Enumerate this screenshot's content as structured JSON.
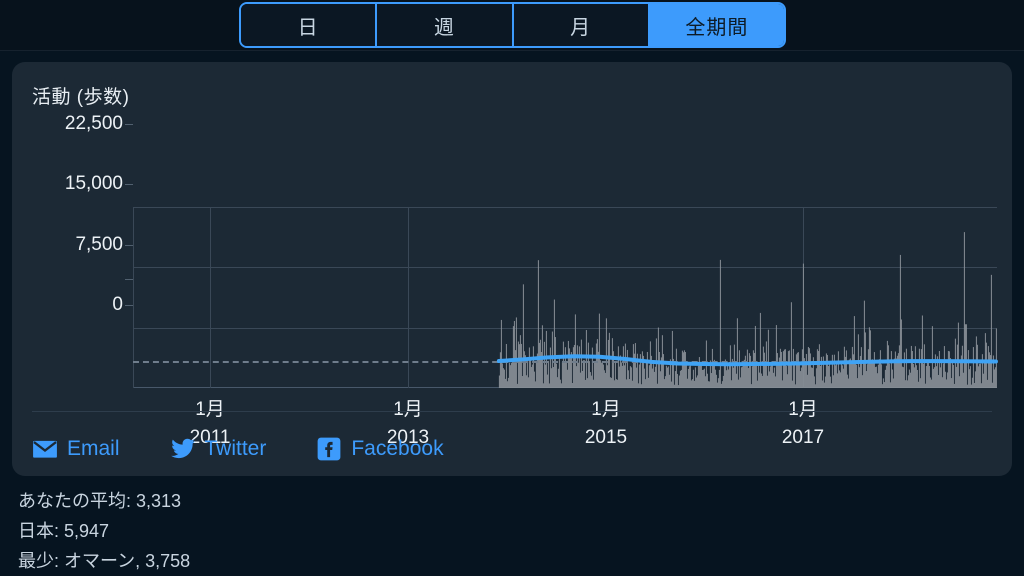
{
  "topbar": {
    "segments": [
      {
        "label": "日",
        "selected": false
      },
      {
        "label": "週",
        "selected": false
      },
      {
        "label": "月",
        "selected": false
      },
      {
        "label": "全期間",
        "selected": true
      }
    ]
  },
  "card": {
    "title": "活動 (歩数)"
  },
  "share": {
    "items": [
      {
        "label": "Email",
        "icon": "email-icon",
        "color": "#3d9bfc"
      },
      {
        "label": "Twitter",
        "icon": "twitter-icon",
        "color": "#3d9bfc"
      },
      {
        "label": "Facebook",
        "icon": "facebook-icon",
        "color": "#3d9bfc"
      }
    ]
  },
  "footer": {
    "lines": [
      "あなたの平均: 3,313",
      "日本: 5,947",
      "最少: オマーン, 3,758"
    ]
  },
  "colors": {
    "accent": "#3d9bfc",
    "page_bg": "#061420",
    "card_bg": "#1c2935",
    "bar": "#8d939b",
    "trend": "#3fa3f5",
    "grid": "#3a4857",
    "dashed": "#6f7d8c"
  },
  "chart_data": {
    "type": "bar",
    "title": "活動 (歩数)",
    "xlabel": "",
    "ylabel": "歩数",
    "ylim": [
      0,
      22500
    ],
    "yticks": [
      0,
      7500,
      15000,
      22500
    ],
    "ytick_labels": [
      "0",
      "7,500",
      "15,000",
      "22,500"
    ],
    "grid": true,
    "legend": "none",
    "x_range": [
      "2010-01",
      "2018-12"
    ],
    "xticks": [
      {
        "position": 0.0893,
        "label_line1": "1月",
        "label_line2": "2011"
      },
      {
        "position": 0.3183,
        "label_line1": "1月",
        "label_line2": "2013"
      },
      {
        "position": 0.5475,
        "label_line1": "1月",
        "label_line2": "2015"
      },
      {
        "position": 0.7755,
        "label_line1": "1月",
        "label_line2": "2017"
      }
    ],
    "annotations": [
      {
        "type": "hline",
        "name": "user-average-reference",
        "value": 3313,
        "style": "dashed",
        "color": "#6f7d8c",
        "spans": "full-width"
      }
    ],
    "series": [
      {
        "name": "daily-steps",
        "type": "bar",
        "color": "#8d939b",
        "data_start_fraction": 0.4235,
        "data_end_fraction": 0.9988,
        "note": "Dense daily step counts; noise band roughly 500-6000 with frequent spikes to 9000-19000",
        "summary": {
          "typical_min": 500,
          "typical_max": 6000,
          "spike_max": 19000
        }
      },
      {
        "name": "smoothed-trend",
        "type": "line",
        "color": "#3fa3f5",
        "values_by_fraction": [
          [
            0.4235,
            3350
          ],
          [
            0.45,
            3550
          ],
          [
            0.48,
            3800
          ],
          [
            0.51,
            3950
          ],
          [
            0.54,
            3880
          ],
          [
            0.57,
            3600
          ],
          [
            0.6,
            3250
          ],
          [
            0.63,
            3050
          ],
          [
            0.66,
            2980
          ],
          [
            0.69,
            2960
          ],
          [
            0.72,
            2980
          ],
          [
            0.75,
            3020
          ],
          [
            0.78,
            3080
          ],
          [
            0.81,
            3150
          ],
          [
            0.84,
            3230
          ],
          [
            0.87,
            3300
          ],
          [
            0.9,
            3340
          ],
          [
            0.93,
            3340
          ],
          [
            0.96,
            3320
          ],
          [
            0.9988,
            3300
          ]
        ]
      }
    ],
    "stats": {
      "your_average": 3313,
      "country_label": "日本",
      "country_average": 5947,
      "lowest_label": "最少",
      "lowest_country": "オマーン",
      "lowest_value": 3758
    }
  }
}
